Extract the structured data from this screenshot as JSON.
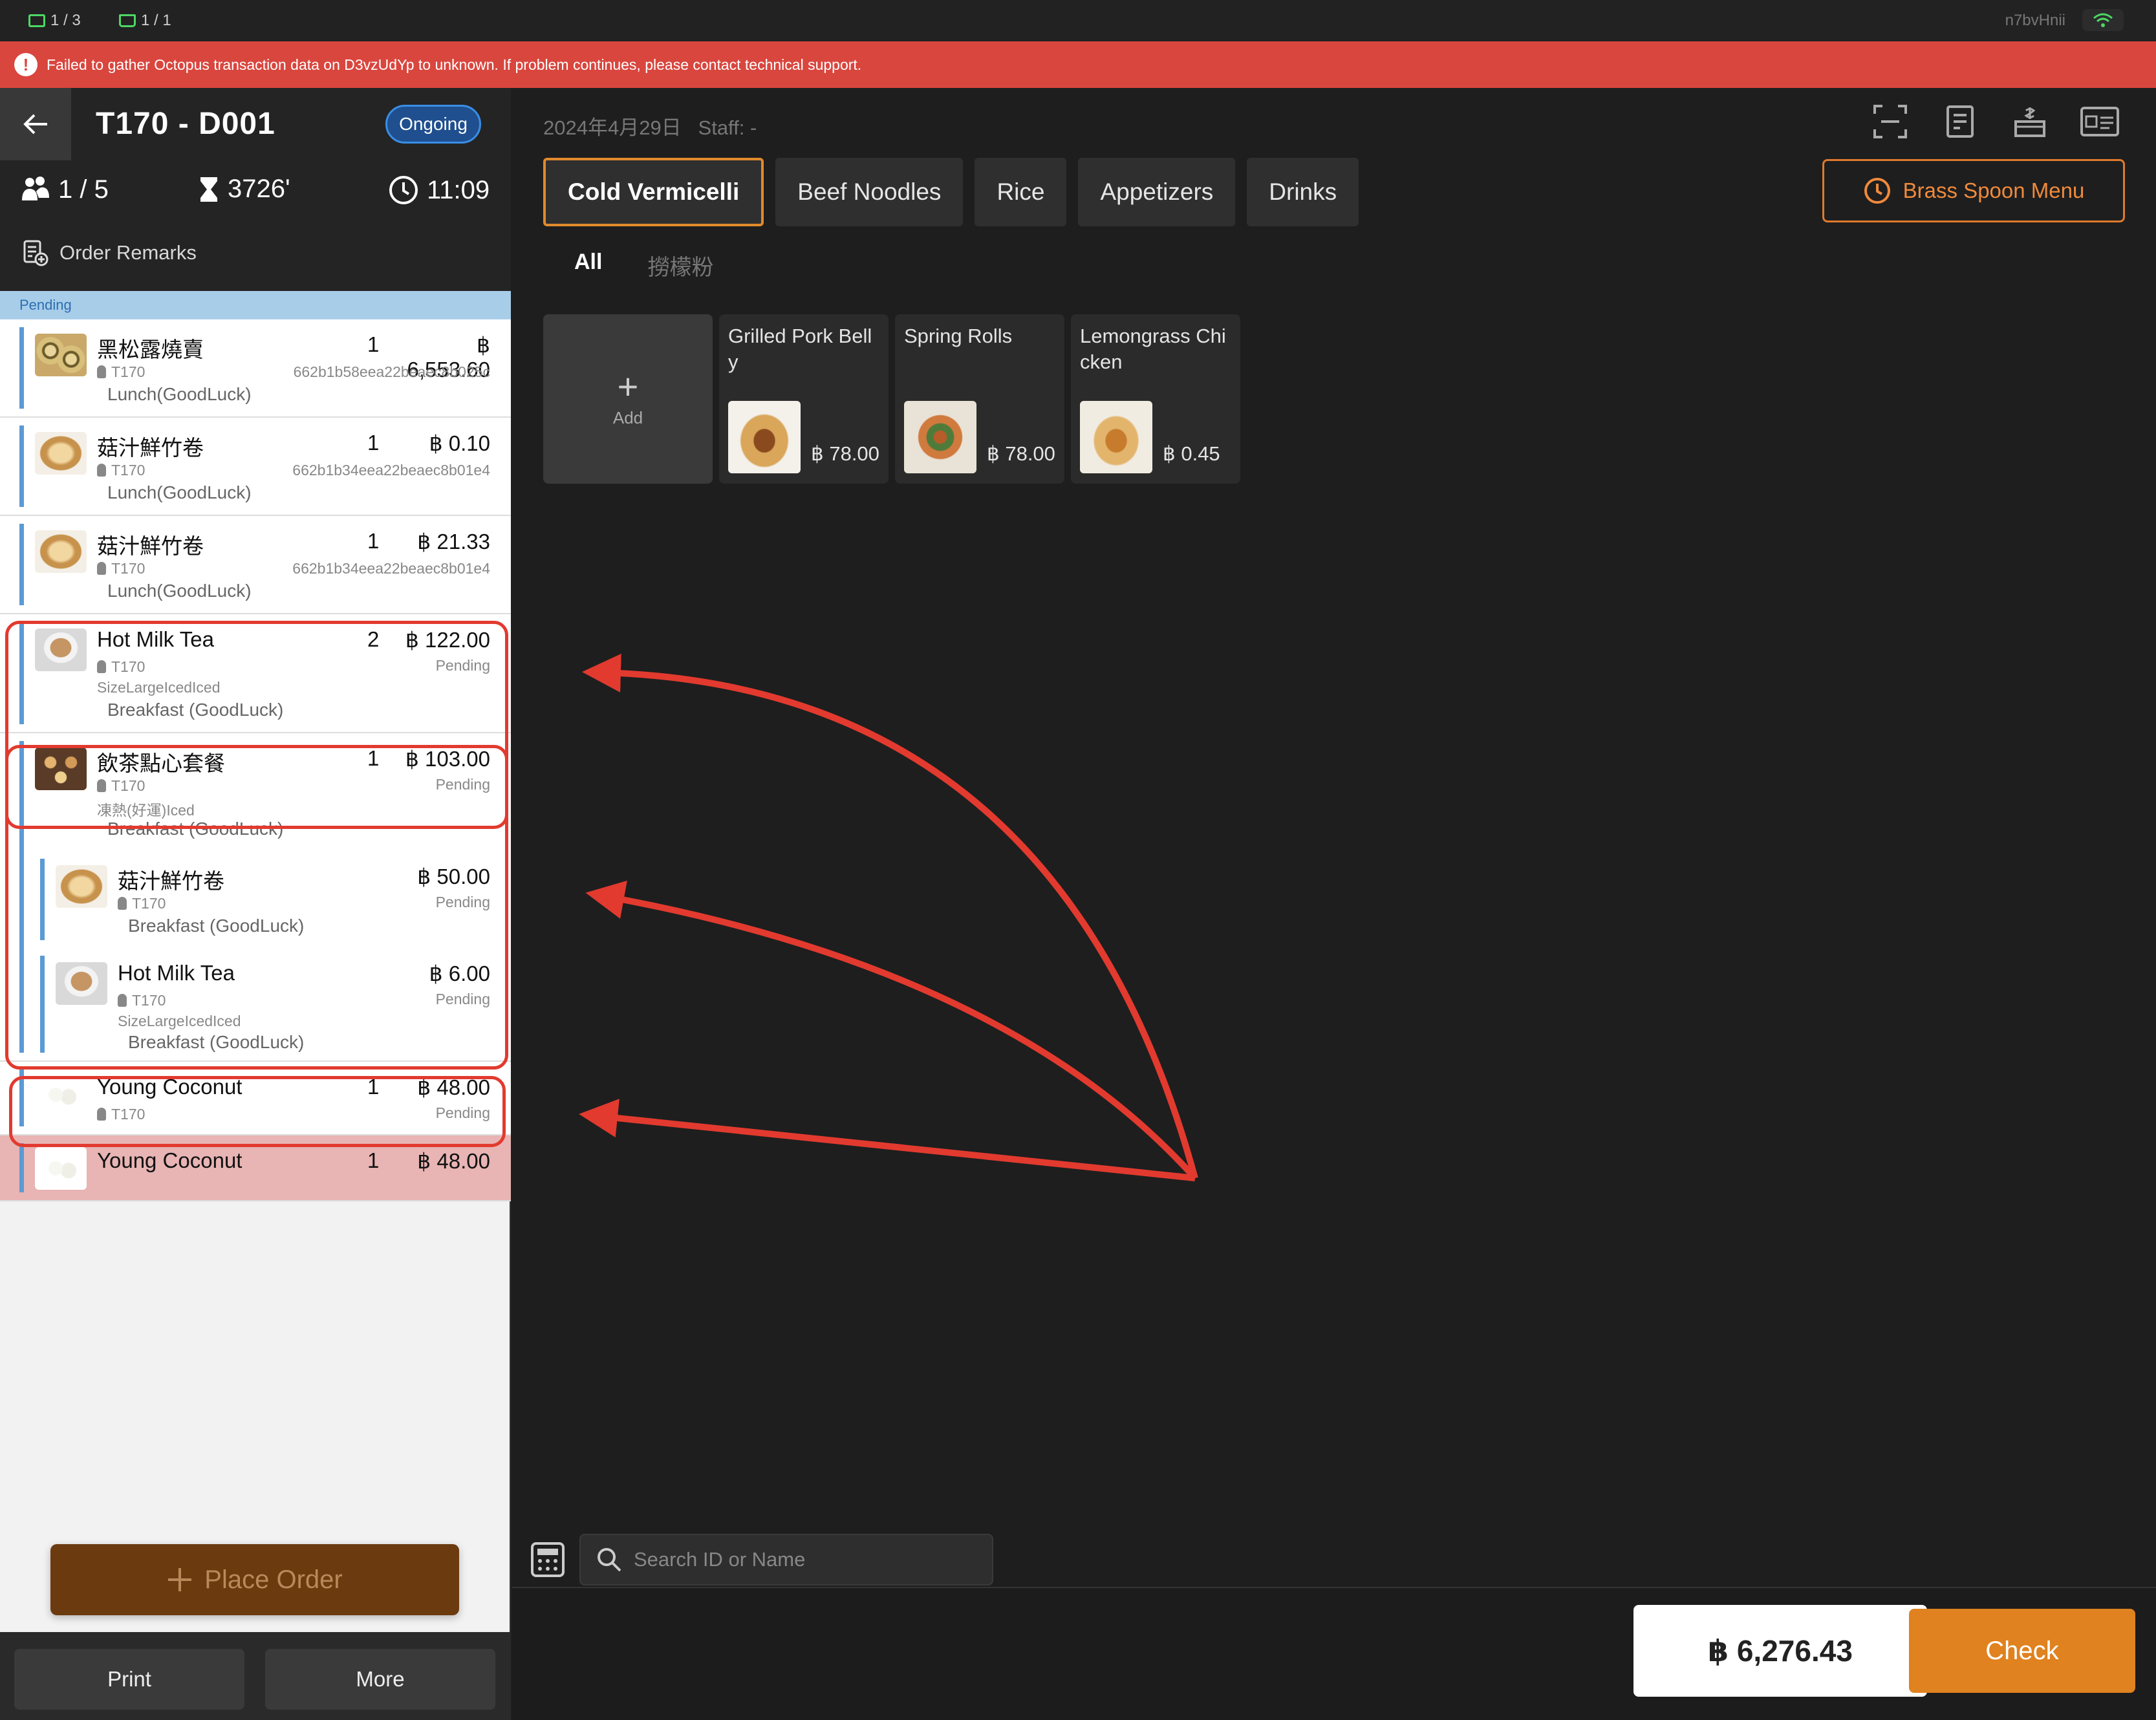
{
  "status_bar": {
    "printers_label": "1 / 3",
    "kitchen_label": "1 / 1",
    "device_id": "n7bvHnii"
  },
  "alert": {
    "icon": "!",
    "message": "Failed to gather Octopus transaction data on D3vzUdYp to unknown. If problem continues, please contact technical support."
  },
  "order": {
    "title": "T170 - D001",
    "status": "Ongoing",
    "guests": "1 / 5",
    "duration": "3726'",
    "time": "11:09",
    "remarks_label": "Order Remarks"
  },
  "pending_label": "Pending",
  "items": [
    {
      "name": "黑松露燒賣",
      "qty": "1",
      "price": "฿ 6,553.60",
      "table": "T170",
      "id": "662b1b58eea22beaec8b025c",
      "meal": "Lunch(GoodLuck)"
    },
    {
      "name": "菇汁鮮竹卷",
      "qty": "1",
      "price": "฿ 0.10",
      "table": "T170",
      "id": "662b1b34eea22beaec8b01e4",
      "meal": "Lunch(GoodLuck)"
    },
    {
      "name": "菇汁鮮竹卷",
      "qty": "1",
      "price": "฿ 21.33",
      "table": "T170",
      "id": "662b1b34eea22beaec8b01e4",
      "meal": "Lunch(GoodLuck)"
    },
    {
      "name": "Hot Milk Tea",
      "qty": "2",
      "price": "฿ 122.00",
      "status": "Pending",
      "table": "T170",
      "options": "SizeLargeIcedIced",
      "meal": "Breakfast (GoodLuck)"
    },
    {
      "name": "飲茶點心套餐",
      "qty": "1",
      "price": "฿ 103.00",
      "status": "Pending",
      "table": "T170",
      "options": "凍熱(好運)Iced",
      "meal": "Breakfast (GoodLuck)"
    },
    {
      "name": "菇汁鮮竹卷",
      "price": "฿ 50.00",
      "status": "Pending",
      "table": "T170",
      "meal": "Breakfast (GoodLuck)"
    },
    {
      "name": "Hot Milk Tea",
      "price": "฿ 6.00",
      "status": "Pending",
      "table": "T170",
      "options": "SizeLargeIcedIced",
      "meal": "Breakfast (GoodLuck)"
    },
    {
      "name": "Young Coconut",
      "qty": "1",
      "price": "฿ 48.00",
      "status": "Pending",
      "table": "T170"
    },
    {
      "name": "Young Coconut",
      "qty": "1",
      "price": "฿ 48.00"
    }
  ],
  "place_order_label": "Place Order",
  "footer": {
    "print_label": "Print",
    "more_label": "More"
  },
  "right": {
    "date": "2024年4月29日",
    "staff": "Staff: -",
    "categories": [
      "Cold Vermicelli",
      "Beef Noodles",
      "Rice",
      "Appetizers",
      "Drinks"
    ],
    "brass_menu_label": "Brass Spoon Menu",
    "sub_tabs": [
      "All",
      "撈檬粉"
    ],
    "add_label": "Add",
    "products": [
      {
        "name": "Grilled Pork Bell y",
        "price": "฿ 78.00"
      },
      {
        "name": "Spring Rolls",
        "price": "฿ 78.00"
      },
      {
        "name": "Lemongrass Chi cken",
        "price": "฿ 0.45"
      }
    ],
    "search_placeholder": "Search ID or Name",
    "total": "฿ 6,276.43",
    "check_label": "Check"
  },
  "colors": {
    "alert": "#d9463e",
    "accent_orange": "#e0821f",
    "ongoing_blue": "#1f4f8e",
    "annotation_red": "#e23a2f",
    "pending_blue": "#a8cde9"
  }
}
